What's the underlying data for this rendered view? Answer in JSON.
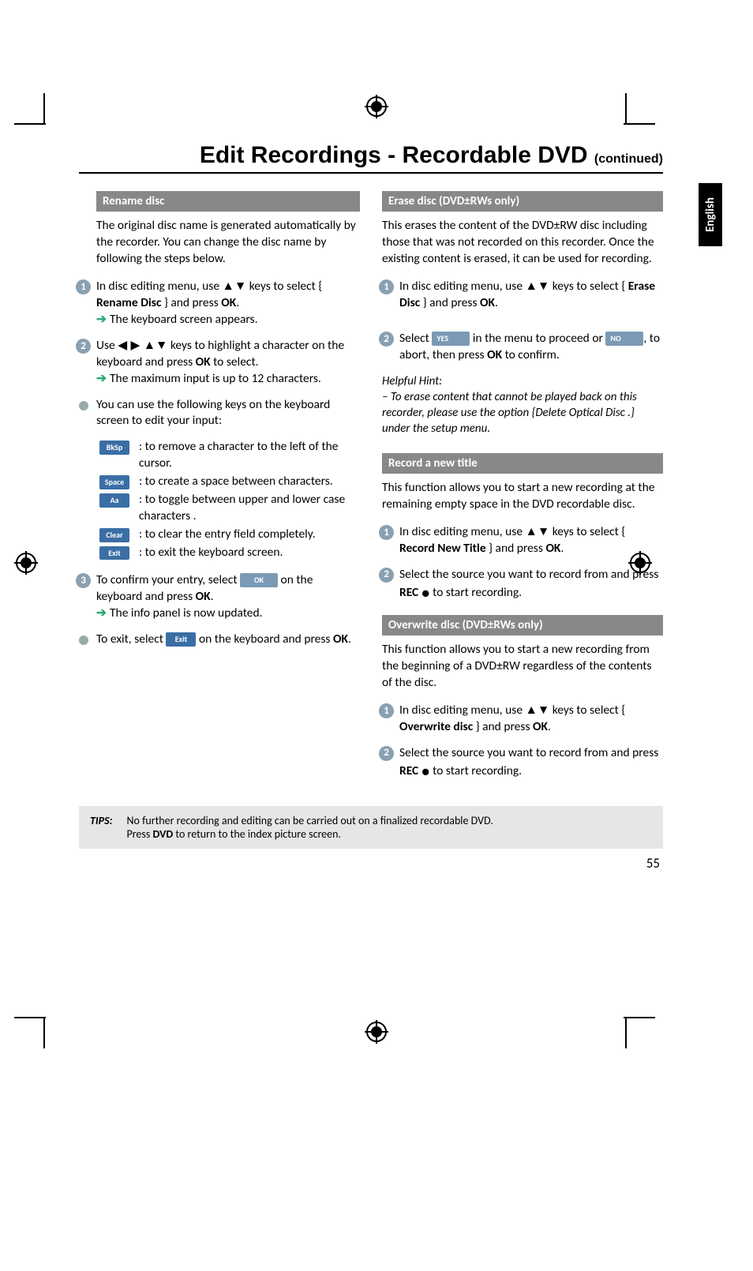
{
  "title_main": "Edit Recordings - Recordable DVD ",
  "title_cont": "(continued)",
  "language_tab": "English",
  "page_number": "55",
  "left": {
    "rename_head": "Rename disc",
    "rename_intro": "The original disc name is generated automatically by the recorder. You can change the disc name by following the steps below.",
    "step1_a": "In disc editing menu, use ",
    "step1_keys": "▲▼",
    "step1_b": " keys to select { ",
    "step1_bold": "Rename Disc",
    "step1_c": " } and press ",
    "step1_ok": "OK",
    "step1_d": ".",
    "step1_sub": "The keyboard screen appears.",
    "step2_a": "Use ",
    "step2_keys": "◀ ▶ ▲▼",
    "step2_b": " keys to highlight a character on the keyboard and press ",
    "step2_ok": "OK",
    "step2_c": " to select.",
    "step2_sub": "The maximum input is up to 12 characters.",
    "keys_intro": "You can use the following keys on the keyboard screen to edit your input:",
    "k_bksp": "BkSp",
    "k_bksp_desc": ": to remove a character to the left of the cursor.",
    "k_space": "Space",
    "k_space_desc": ": to create a space between characters.",
    "k_aa": "Aa",
    "k_aa_desc": ": to toggle between upper and lower case characters .",
    "k_clear": "Clear",
    "k_clear_desc": ": to clear the entry field completely.",
    "k_exit": "Exit",
    "k_exit_desc": ": to exit the keyboard screen.",
    "step3_a": "To confirm your entry, select ",
    "step3_okbtn": "OK",
    "step3_b": " on the keyboard and press ",
    "step3_ok": "OK",
    "step3_c": ".",
    "step3_sub": "The info panel is now updated.",
    "exit_a": "To exit, select ",
    "exit_btn": "Exit",
    "exit_b": " on the keyboard and press ",
    "exit_ok": "OK",
    "exit_c": "."
  },
  "right": {
    "erase_head": "Erase disc (DVD±RWs only)",
    "erase_intro": "This erases the content of the DVD±RW disc including those that was not recorded on this recorder. Once the existing content is erased, it can be used for recording.",
    "e_step1_a": "In disc editing menu, use ",
    "e_step1_keys": "▲▼",
    "e_step1_b": " keys to select { ",
    "e_step1_bold": "Erase Disc",
    "e_step1_c": " } and press ",
    "e_step1_ok": "OK",
    "e_step1_d": ".",
    "e_step2_a": "Select ",
    "e_yes": "YES",
    "e_step2_b": " in the menu to proceed or ",
    "e_no": "NO",
    "e_step2_c": ", to abort, then press ",
    "e_step2_ok": "OK",
    "e_step2_d": " to confirm.",
    "hint_label": "Helpful Hint:",
    "hint_text": "– To erase content that cannot be played back on this recorder, please use the option {Delete Optical Disc .} under the setup menu.",
    "rec_head": "Record a new title",
    "rec_intro": "This function allows you to start a new recording at the remaining empty space in the DVD recordable disc.",
    "r_step1_a": "In disc editing menu, use ",
    "r_step1_keys": "▲▼",
    "r_step1_b": " keys to select { ",
    "r_step1_bold": "Record New Title",
    "r_step1_c": " } and press ",
    "r_step1_ok": "OK",
    "r_step1_d": ".",
    "r_step2_a": "Select the source you want to record from and press ",
    "r_step2_rec": "REC",
    "r_step2_b": " to start recording.",
    "ovr_head": "Overwrite disc (DVD±RWs only)",
    "ovr_intro": "This function allows you to start a new recording from the beginning of a DVD±RW regardless of the contents of the disc.",
    "o_step1_a": "In disc editing menu, use ",
    "o_step1_keys": "▲▼",
    "o_step1_b": " keys to select { ",
    "o_step1_bold": "Overwrite disc",
    "o_step1_c": " } and press ",
    "o_step1_ok": "OK",
    "o_step1_d": ".",
    "o_step2_a": "Select the source you want to record from and press ",
    "o_step2_rec": "REC",
    "o_step2_b": " to start recording."
  },
  "tips_label": "TIPS:",
  "tips_line1": "No further recording and editing can be carried out on a finalized recordable DVD.",
  "tips_line2a": "Press ",
  "tips_line2_bold": "DVD",
  "tips_line2b": " to return to the index picture screen."
}
